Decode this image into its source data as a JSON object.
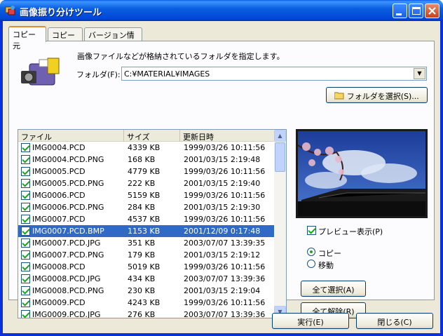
{
  "window": {
    "title": "画像振り分けツール"
  },
  "tabs": [
    {
      "label": "コピー元",
      "active": true
    },
    {
      "label": "コピー先",
      "active": false
    },
    {
      "label": "バージョン情報",
      "active": false
    }
  ],
  "source": {
    "hint": "画像ファイルなどが格納されているフォルダを指定します。",
    "folder_label": "フォルダ(F):",
    "folder_value": "C:¥MATERIAL¥IMAGES",
    "select_folder_button": "フォルダを選択(S)..."
  },
  "file_list": {
    "columns": [
      "ファイル",
      "サイズ",
      "更新日時"
    ],
    "rows": [
      {
        "name": "IMG0004.PCD",
        "size": "4339 KB",
        "date": "1999/03/26 10:11:56",
        "checked": true
      },
      {
        "name": "IMG0004.PCD.PNG",
        "size": "168 KB",
        "date": "2001/03/15 2:19:48",
        "checked": true
      },
      {
        "name": "IMG0005.PCD",
        "size": "4779 KB",
        "date": "1999/03/26 10:11:56",
        "checked": true
      },
      {
        "name": "IMG0005.PCD.PNG",
        "size": "222 KB",
        "date": "2001/03/15 2:19:40",
        "checked": true
      },
      {
        "name": "IMG0006.PCD",
        "size": "5159 KB",
        "date": "1999/03/26 10:11:56",
        "checked": true
      },
      {
        "name": "IMG0006.PCD.PNG",
        "size": "284 KB",
        "date": "2001/03/15 2:19:30",
        "checked": true
      },
      {
        "name": "IMG0007.PCD",
        "size": "4537 KB",
        "date": "1999/03/26 10:11:56",
        "checked": true
      },
      {
        "name": "IMG0007.PCD.BMP",
        "size": "1153 KB",
        "date": "2001/12/09 0:17:48",
        "checked": true,
        "selected": true
      },
      {
        "name": "IMG0007.PCD.JPG",
        "size": "351 KB",
        "date": "2003/07/07 13:39:35",
        "checked": true
      },
      {
        "name": "IMG0007.PCD.PNG",
        "size": "179 KB",
        "date": "2001/03/15 2:19:12",
        "checked": true
      },
      {
        "name": "IMG0008.PCD",
        "size": "5019 KB",
        "date": "1999/03/26 10:11:56",
        "checked": true
      },
      {
        "name": "IMG0008.PCD.JPG",
        "size": "434 KB",
        "date": "2003/07/07 13:39:36",
        "checked": true
      },
      {
        "name": "IMG0008.PCD.PNG",
        "size": "230 KB",
        "date": "2001/03/15 2:19:04",
        "checked": true
      },
      {
        "name": "IMG0009.PCD",
        "size": "4243 KB",
        "date": "1999/03/26 10:11:56",
        "checked": true
      },
      {
        "name": "IMG0009.PCD.JPG",
        "size": "276 KB",
        "date": "2003/07/07 13:39:36",
        "checked": true
      }
    ]
  },
  "preview_toggle": {
    "label": "プレビュー表示(P)",
    "checked": true
  },
  "mode": {
    "options": [
      {
        "label": "コピー",
        "selected": true
      },
      {
        "label": "移動",
        "selected": false
      }
    ]
  },
  "buttons": {
    "select_all": "全て選択(A)",
    "deselect_all": "全て解除(R)",
    "run": "実行(E)",
    "close": "閉じる(C)"
  },
  "colors": {
    "selection": "#316ac5",
    "titlebar": "#0a5fea",
    "face": "#ece9d8"
  }
}
